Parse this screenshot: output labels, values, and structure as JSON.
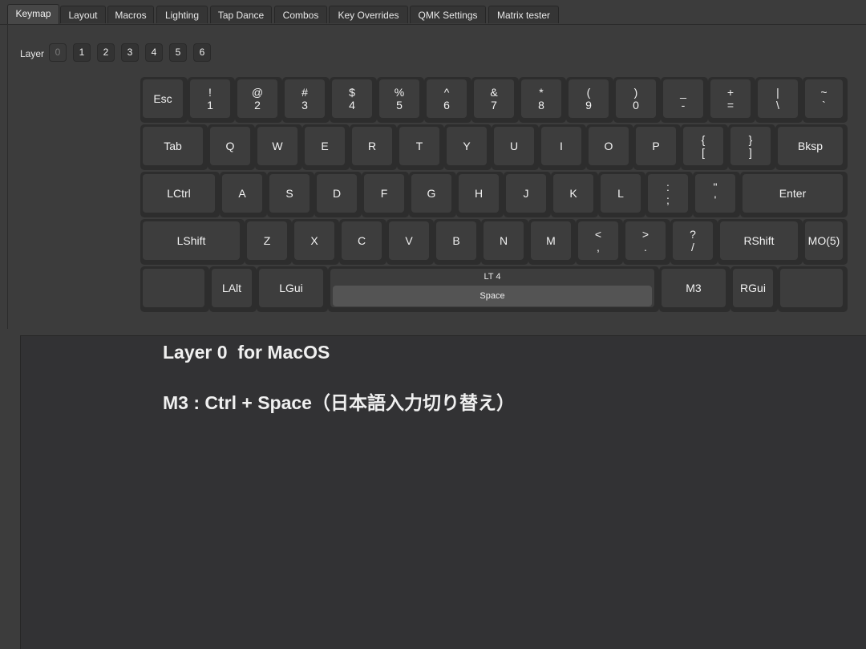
{
  "tabs": [
    {
      "label": "Keymap",
      "active": true
    },
    {
      "label": "Layout"
    },
    {
      "label": "Macros"
    },
    {
      "label": "Lighting"
    },
    {
      "label": "Tap Dance"
    },
    {
      "label": "Combos"
    },
    {
      "label": "Key Overrides"
    },
    {
      "label": "QMK Settings"
    },
    {
      "label": "Matrix tester"
    }
  ],
  "layer_selector": {
    "label": "Layer",
    "layers": [
      "0",
      "1",
      "2",
      "3",
      "4",
      "5",
      "6"
    ],
    "active": "0"
  },
  "keyboard": {
    "rows": [
      [
        {
          "l1": "Esc"
        },
        {
          "l1": "!",
          "l2": "1"
        },
        {
          "l1": "@",
          "l2": "2"
        },
        {
          "l1": "#",
          "l2": "3"
        },
        {
          "l1": "$",
          "l2": "4"
        },
        {
          "l1": "%",
          "l2": "5"
        },
        {
          "l1": "^",
          "l2": "6"
        },
        {
          "l1": "&",
          "l2": "7"
        },
        {
          "l1": "*",
          "l2": "8"
        },
        {
          "l1": "(",
          "l2": "9"
        },
        {
          "l1": ")",
          "l2": "0"
        },
        {
          "l1": "_",
          "l2": "-"
        },
        {
          "l1": "+",
          "l2": "="
        },
        {
          "l1": "|",
          "l2": "\\"
        },
        {
          "l1": "~",
          "l2": "`"
        }
      ],
      [
        {
          "l1": "Tab"
        },
        {
          "l1": "Q"
        },
        {
          "l1": "W"
        },
        {
          "l1": "E"
        },
        {
          "l1": "R"
        },
        {
          "l1": "T"
        },
        {
          "l1": "Y"
        },
        {
          "l1": "U"
        },
        {
          "l1": "I"
        },
        {
          "l1": "O"
        },
        {
          "l1": "P"
        },
        {
          "l1": "{",
          "l2": "["
        },
        {
          "l1": "}",
          "l2": "]"
        },
        {
          "l1": "Bksp"
        }
      ],
      [
        {
          "l1": "LCtrl"
        },
        {
          "l1": "A"
        },
        {
          "l1": "S"
        },
        {
          "l1": "D"
        },
        {
          "l1": "F"
        },
        {
          "l1": "G"
        },
        {
          "l1": "H"
        },
        {
          "l1": "J"
        },
        {
          "l1": "K"
        },
        {
          "l1": "L"
        },
        {
          "l1": ":",
          "l2": ";"
        },
        {
          "l1": "\"",
          "l2": "'"
        },
        {
          "l1": "Enter"
        }
      ],
      [
        {
          "l1": "LShift"
        },
        {
          "l1": "Z"
        },
        {
          "l1": "X"
        },
        {
          "l1": "C"
        },
        {
          "l1": "V"
        },
        {
          "l1": "B"
        },
        {
          "l1": "N"
        },
        {
          "l1": "M"
        },
        {
          "l1": "<",
          "l2": ","
        },
        {
          "l1": ">",
          "l2": "."
        },
        {
          "l1": "?",
          "l2": "/"
        },
        {
          "l1": "RShift"
        },
        {
          "l1": "MO(5)"
        }
      ],
      [
        {
          "l1": ""
        },
        {
          "l1": "LAlt"
        },
        {
          "l1": "LGui"
        },
        {
          "top": "LT 4",
          "bar": "Space"
        },
        {
          "l1": "M3"
        },
        {
          "l1": "RGui"
        },
        {
          "l1": ""
        }
      ]
    ]
  },
  "notes": {
    "line1": "Layer 0  for MacOS",
    "line2": "M3 : Ctrl + Space（日本語入力切り替え）"
  }
}
